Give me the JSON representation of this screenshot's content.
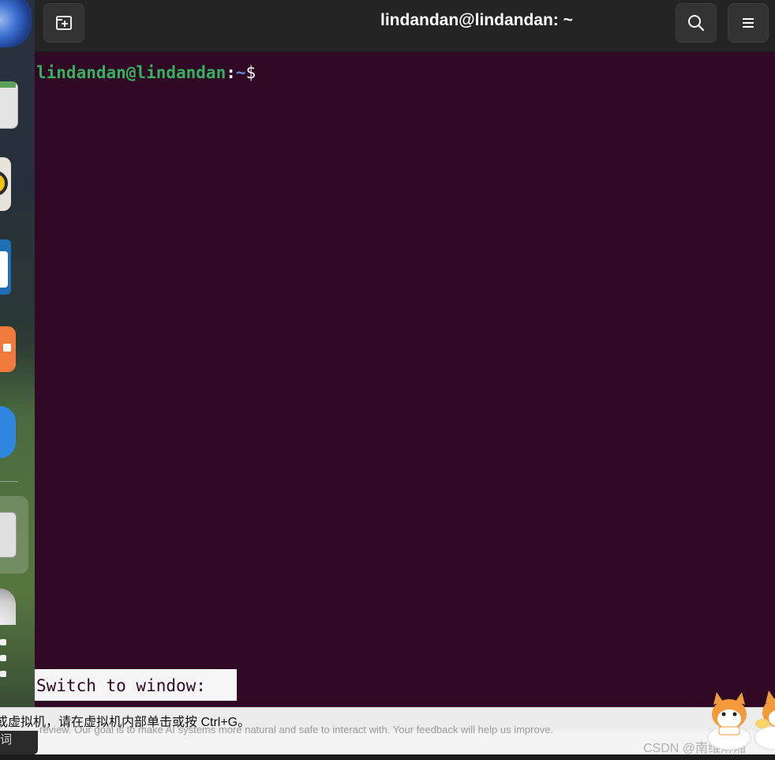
{
  "window": {
    "title": "lindandan@lindandan: ~",
    "buttons": {
      "new_tab_icon": "new-tab-icon",
      "search_icon": "search-icon",
      "menu_icon": "hamburger-menu-icon"
    }
  },
  "terminal": {
    "prompt_user_host": "lindandan@lindandan",
    "prompt_colon": ":",
    "prompt_path": "~",
    "prompt_symbol": "$",
    "switch_to_window": "Switch to window:"
  },
  "hint_bar": {
    "text": "或虚拟机，请在虚拟机内部单击或按 Ctrl+G。",
    "left_fragment": "词"
  },
  "footer": {
    "feedback_text": "review. Our goal is to make AI systems more natural and safe to interact with. Your feedback will help us improve.",
    "watermark": "CSDN @南维淋湘"
  },
  "colors": {
    "terminal_bg": "#300a24",
    "headerbar_bg": "#242424",
    "prompt_user": "#35b05e",
    "prompt_path": "#5a8ad6"
  },
  "dock": {
    "items": [
      "browser-icon",
      "files-icon",
      "rhythmbox-icon",
      "writer-icon",
      "software-store-icon",
      "help-icon",
      "terminal-icon",
      "disk-icon",
      "show-apps-icon"
    ]
  }
}
